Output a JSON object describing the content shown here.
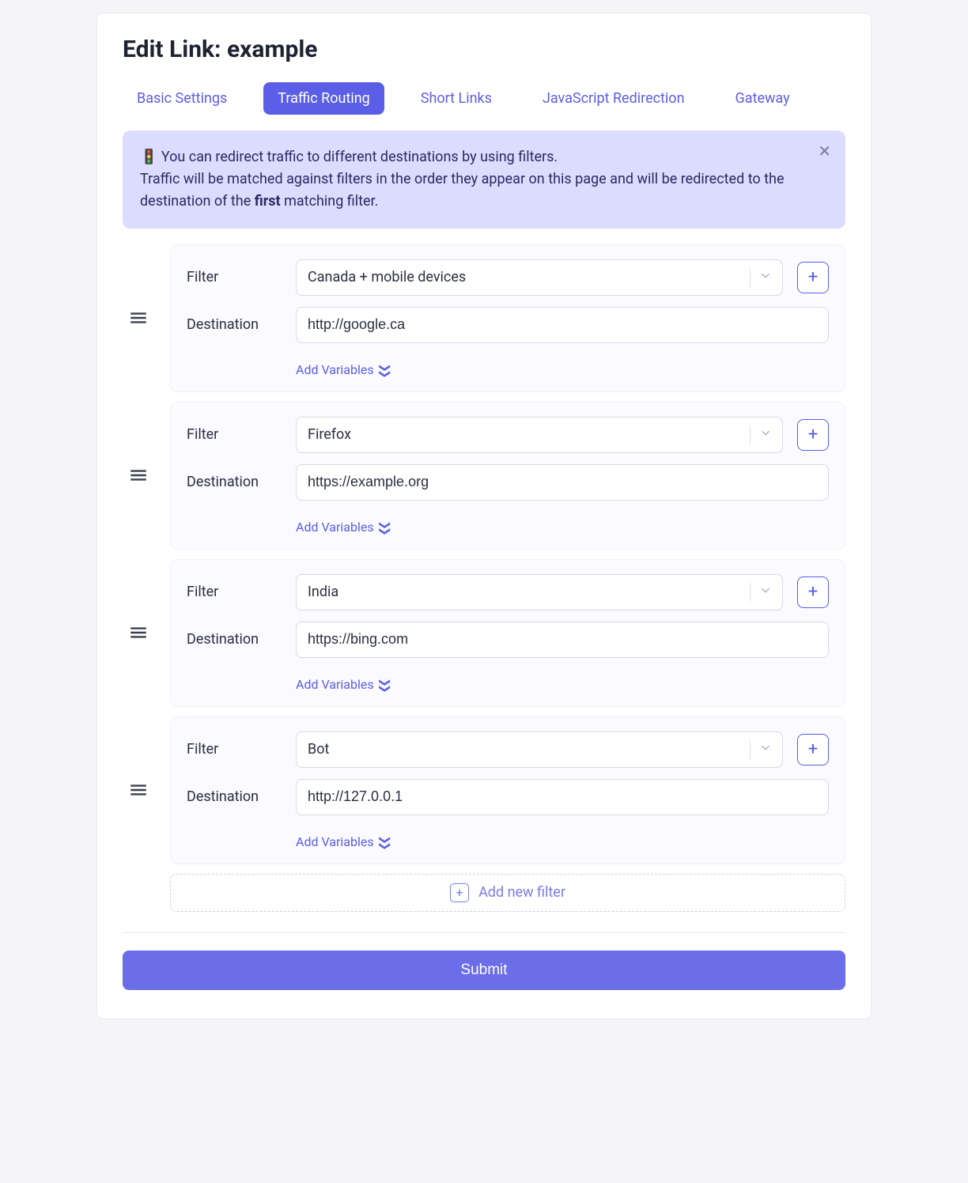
{
  "page_title": "Edit Link: example",
  "tabs": [
    {
      "label": "Basic Settings",
      "active": false
    },
    {
      "label": "Traffic Routing",
      "active": true
    },
    {
      "label": "Short Links",
      "active": false
    },
    {
      "label": "JavaScript Redirection",
      "active": false
    },
    {
      "label": "Gateway",
      "active": false
    }
  ],
  "alert": {
    "line1_prefix": "🚦 ",
    "line1": "You can redirect traffic to different destinations by using filters.",
    "line2a": "Traffic will be matched against filters in the order they appear on this page and will be redirected to the destination of the ",
    "line2_bold": "first",
    "line2b": " matching filter."
  },
  "labels": {
    "filter": "Filter",
    "destination": "Destination",
    "add_variables": "Add Variables",
    "add_new_filter": "Add new filter",
    "submit": "Submit"
  },
  "filters": [
    {
      "filter": "Canada + mobile devices",
      "destination": "http://google.ca"
    },
    {
      "filter": "Firefox",
      "destination": "https://example.org"
    },
    {
      "filter": "India",
      "destination": "https://bing.com"
    },
    {
      "filter": "Bot",
      "destination": "http://127.0.0.1"
    }
  ],
  "colors": {
    "primary": "#5b5ee6",
    "alert_bg": "#dcdcff",
    "card_bg": "#fafaff"
  }
}
